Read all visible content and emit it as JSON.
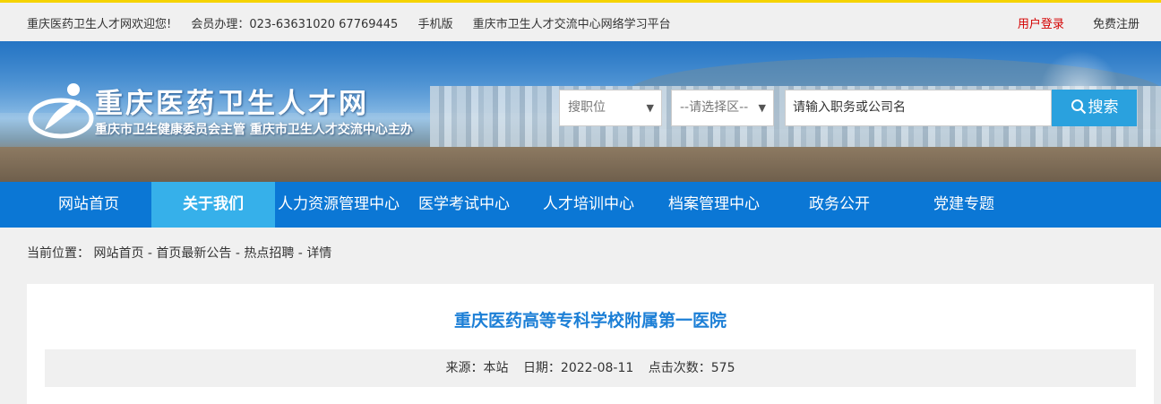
{
  "topbar": {
    "welcome": "重庆医药卫生人才网欢迎您!",
    "hotline": "会员办理：023-63631020 67769445",
    "mobile": "手机版",
    "platform": "重庆市卫生人才交流中心网络学习平台",
    "login": "用户登录",
    "register": "免费注册"
  },
  "header": {
    "title": "重庆医药卫生人才网",
    "subtitle": "重庆市卫生健康委员会主管 重庆市卫生人才交流中心主办"
  },
  "search": {
    "job_select": "搜职位",
    "area_select": "--请选择区--",
    "placeholder": "请输入职务或公司名",
    "button": "搜索"
  },
  "nav": {
    "items": [
      "网站首页",
      "关于我们",
      "人力资源管理中心",
      "医学考试中心",
      "人才培训中心",
      "档案管理中心",
      "政务公开",
      "党建专题"
    ],
    "active_index": 1
  },
  "breadcrumb": {
    "label": "当前位置：",
    "path": [
      "网站首页",
      "首页最新公告",
      "热点招聘",
      "详情"
    ],
    "sep": " - "
  },
  "article": {
    "title": "重庆医药高等专科学校附属第一医院",
    "source": "来源：本站",
    "date": "日期：2022-08-11",
    "views": "点击次数：575"
  },
  "colors": {
    "accent_top": "#f5d300",
    "nav_bg": "#0b77d5",
    "nav_active": "#36b0ea",
    "search_btn": "#2aa1de",
    "title_blue": "#1c7fd6",
    "login_red": "#d40000"
  }
}
